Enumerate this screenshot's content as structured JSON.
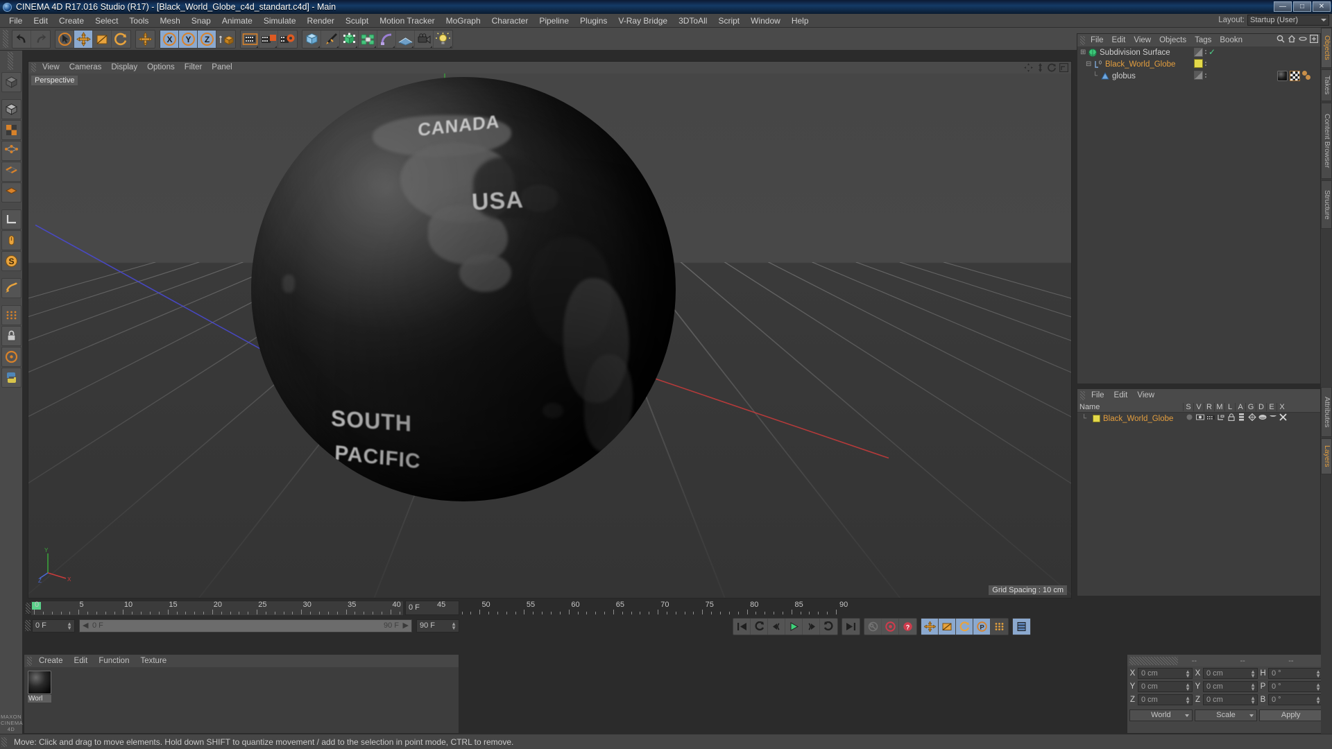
{
  "window": {
    "title": "CINEMA 4D R17.016 Studio (R17) - [Black_World_Globe_c4d_standart.c4d] - Main",
    "minimize": "—",
    "maximize": "□",
    "close": "✕"
  },
  "menubar": {
    "items": [
      "File",
      "Edit",
      "Create",
      "Select",
      "Tools",
      "Mesh",
      "Snap",
      "Animate",
      "Simulate",
      "Render",
      "Sculpt",
      "Motion Tracker",
      "MoGraph",
      "Character",
      "Pipeline",
      "Plugins",
      "V-Ray Bridge",
      "3DToAll",
      "Script",
      "Window",
      "Help"
    ],
    "layout_label": "Layout:",
    "layout_value": "Startup (User)"
  },
  "toolbar": {
    "undo": "undo-arrow",
    "redo": "redo-arrow",
    "live_selection": "cursor-select",
    "move": "move-arrows",
    "scale": "scale-box",
    "rotate": "rotate-circle",
    "move2": "move-arrows-2",
    "axis_x": "X",
    "axis_y": "Y",
    "axis_z": "Z",
    "world_object": "world-axis-cube",
    "render_view": "render-view",
    "render_region": "render-region",
    "render_settings": "render-settings",
    "cube": "primitive-cube",
    "spline": "spline-pen",
    "nurbs": "generator-nurbs",
    "array": "array-modeling",
    "deformer": "deformer-bend",
    "env": "environment-floor",
    "camera": "camera",
    "light": "light-bulb"
  },
  "viewport": {
    "menu": [
      "View",
      "Cameras",
      "Display",
      "Options",
      "Filter",
      "Panel"
    ],
    "label": "Perspective",
    "grid_spacing": "Grid Spacing : 10 cm",
    "axis_labels": {
      "y": "Y",
      "x": "X",
      "z": "Z"
    },
    "globe_texts": [
      "CANADA",
      "USA",
      "SOUTH",
      "PACIFIC"
    ]
  },
  "timeline": {
    "ticks": [
      "0",
      "5",
      "10",
      "15",
      "20",
      "25",
      "30",
      "35",
      "40",
      "45",
      "50",
      "55",
      "60",
      "65",
      "70",
      "75",
      "80",
      "85",
      "90"
    ],
    "current_frame_top": "0 F",
    "start_frame": "0 F",
    "current_frame": "0 F",
    "end_frame_left": "90 F",
    "end_frame_right": "90 F",
    "transport": [
      "go-to-start",
      "step-back-key",
      "frame-back",
      "play",
      "frame-forward",
      "step-forward-key",
      "go-to-end"
    ],
    "record_tools": [
      "autokey-off",
      "record-active-objects",
      "record-help"
    ],
    "key_tools": [
      "key-position",
      "key-scale",
      "key-rotation",
      "key-parameter",
      "key-pla",
      "animation-layer"
    ]
  },
  "material_manager": {
    "menu": [
      "Create",
      "Edit",
      "Function",
      "Texture"
    ],
    "materials": [
      {
        "name": "Worl"
      }
    ]
  },
  "coordinates": {
    "headers": [
      "--",
      "--",
      "--"
    ],
    "rows": [
      {
        "pos_label": "X",
        "pos_value": "0 cm",
        "size_label": "X",
        "size_value": "0 cm",
        "rot_label": "H",
        "rot_value": "0 °"
      },
      {
        "pos_label": "Y",
        "pos_value": "0 cm",
        "size_label": "Y",
        "size_value": "0 cm",
        "rot_label": "P",
        "rot_value": "0 °"
      },
      {
        "pos_label": "Z",
        "pos_value": "0 cm",
        "size_label": "Z",
        "size_value": "0 cm",
        "rot_label": "B",
        "rot_value": "0 °"
      }
    ],
    "coord_system": "World",
    "size_mode": "Scale",
    "apply": "Apply"
  },
  "object_manager": {
    "menu": [
      "File",
      "Edit",
      "View",
      "Objects",
      "Tags",
      "Bookn"
    ],
    "icons": [
      "search-icon",
      "home-icon",
      "ellipse-icon",
      "expand-icon"
    ],
    "objects": [
      {
        "name": "Subdivision Surface",
        "type": "subdivision-surface",
        "indent": 0,
        "check": "✓"
      },
      {
        "name": "Black_World_Globe",
        "type": "null-layer",
        "indent": 1,
        "swatch": "#e3d94a"
      },
      {
        "name": "globus",
        "type": "polygon-object",
        "indent": 2
      }
    ]
  },
  "layer_manager": {
    "menu": [
      "File",
      "Edit",
      "View"
    ],
    "columns": [
      "Name",
      "S",
      "V",
      "R",
      "M",
      "L",
      "A",
      "G",
      "D",
      "E",
      "X"
    ],
    "rows": [
      {
        "name": "Black_World_Globe",
        "color": "#e3d94a"
      }
    ]
  },
  "right_tabs": {
    "top": [
      "Objects",
      "Takes",
      "Content Browser",
      "Structure"
    ],
    "bottom": [
      "Attributes",
      "Layers"
    ],
    "active_top": "Objects",
    "active_bottom": "Layers"
  },
  "statusbar": {
    "message": "Move: Click and drag to move elements. Hold down SHIFT to quantize movement / add to the selection in point mode, CTRL to remove."
  },
  "branding": {
    "line1": "MAXON",
    "line2": "CINEMA 4D"
  },
  "colors": {
    "accent_orange": "#e39e3e",
    "active_blue": "#8ba9cf",
    "panel_bg": "#3d3d3d",
    "toolbar_bg": "#4a4a4a",
    "titlebar_blue": "#143a66",
    "green_play": "#3fd07a"
  }
}
